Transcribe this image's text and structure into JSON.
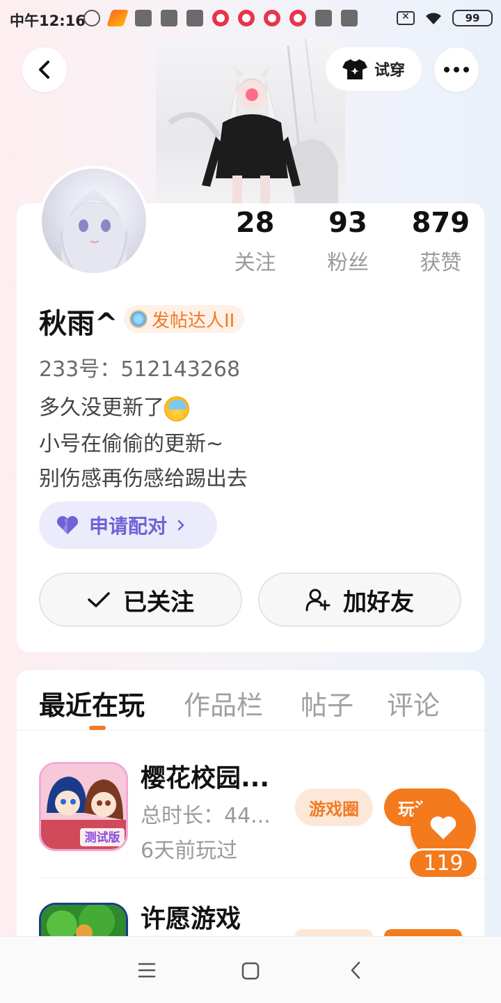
{
  "status_bar": {
    "time": "中午12:16",
    "battery": "99"
  },
  "header": {
    "try_on_label": "试穿"
  },
  "profile": {
    "stats": [
      {
        "value": "28",
        "label": "关注"
      },
      {
        "value": "93",
        "label": "粉丝"
      },
      {
        "value": "879",
        "label": "获赞"
      }
    ],
    "username": "秋雨^",
    "badge": "发帖达人II",
    "uid": "233号：512143268",
    "bio": [
      "多久没更新了",
      "小号在偷偷的更新~",
      "别伤感再伤感给踢出去"
    ],
    "pair_label": "申请配对",
    "followed_label": "已关注",
    "add_friend_label": "加好友"
  },
  "tabs": [
    {
      "label": "最近在玩",
      "active": true
    },
    {
      "label": "作品栏",
      "active": false
    },
    {
      "label": "帖子",
      "active": false
    },
    {
      "label": "评论",
      "active": false
    }
  ],
  "games": [
    {
      "title": "樱花校园...",
      "duration": "总时长：44...",
      "last_played": "6天前玩过",
      "circle_label": "游戏圈",
      "play_label": "玩游戏",
      "icon_badge": "测试版"
    },
    {
      "title": "许愿游戏"
    }
  ],
  "like_fab": {
    "count": "119"
  },
  "colors": {
    "accent": "#f47a1e",
    "pair": "#6d63d6"
  }
}
